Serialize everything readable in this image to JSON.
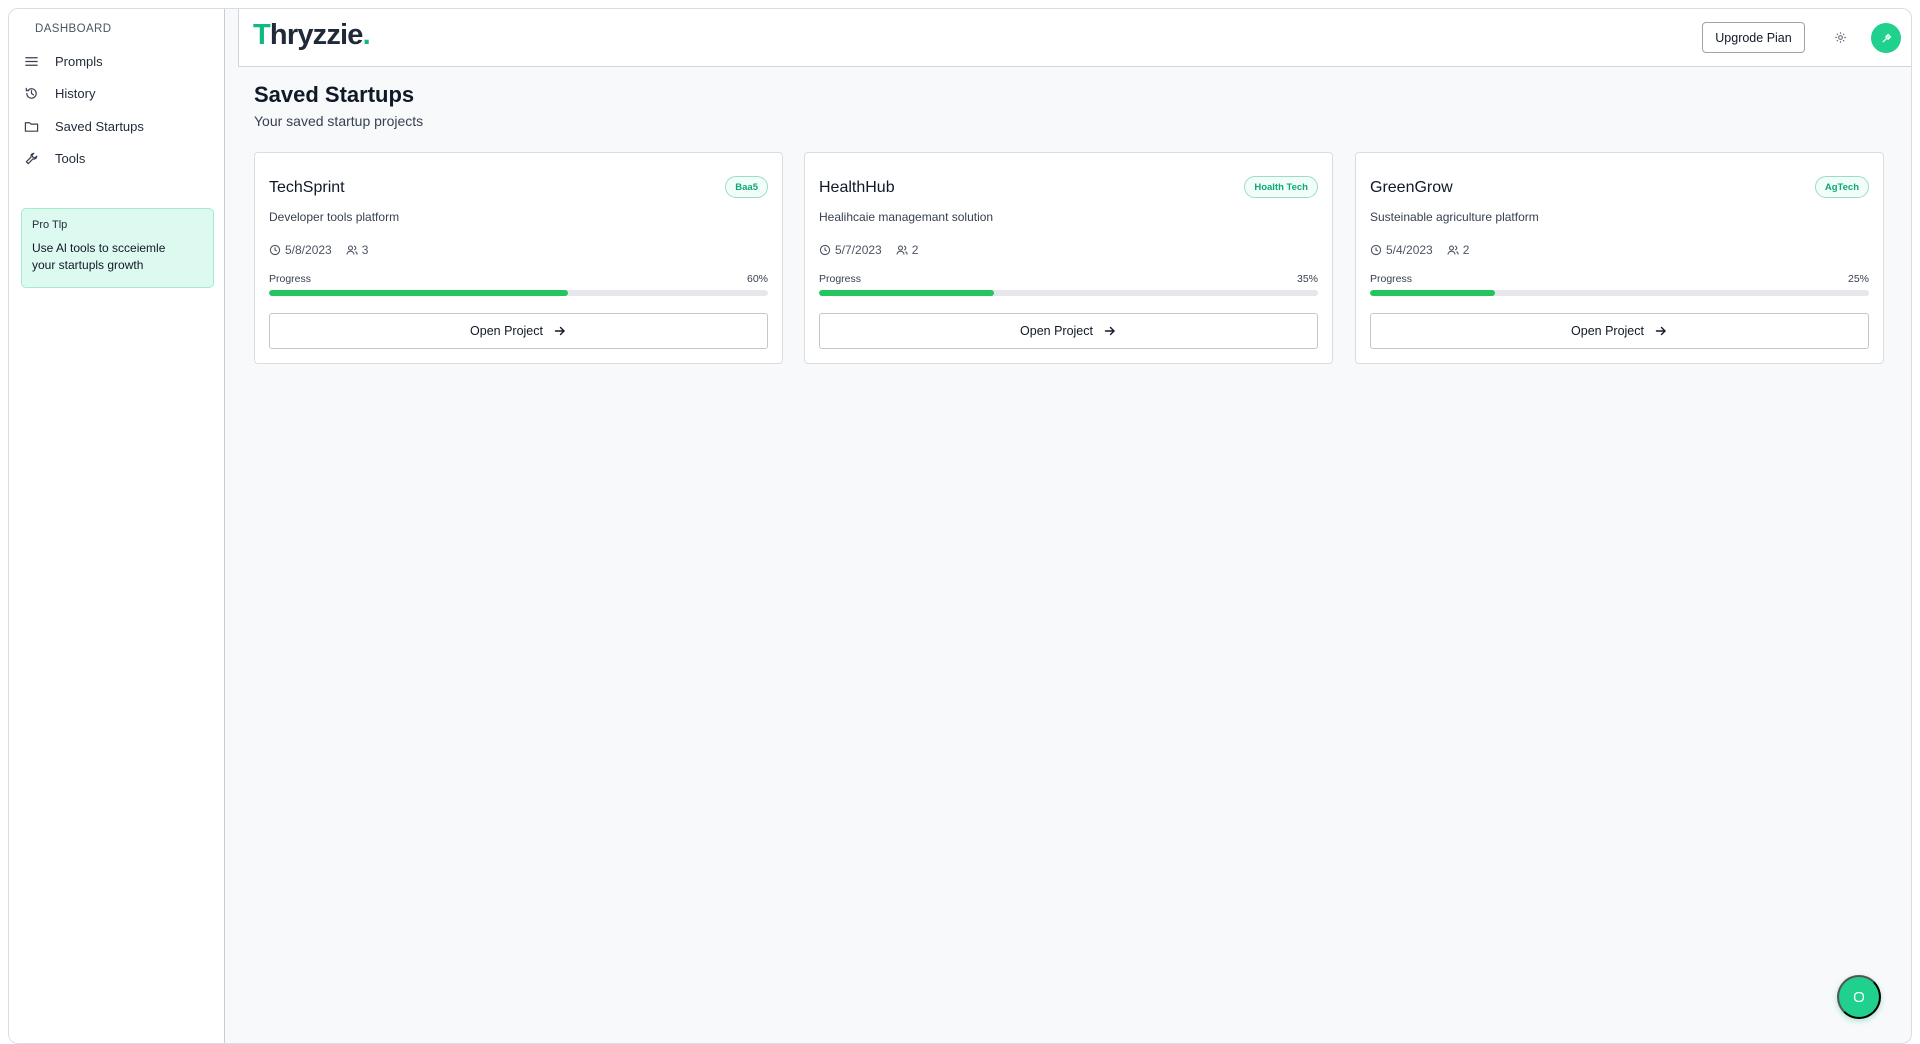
{
  "app": {
    "logo_first": "T",
    "logo_rest": "hryzzie",
    "logo_dot": ".",
    "accent_color": "#10b981"
  },
  "sidebar": {
    "section_title": "DASHBOARD",
    "items": [
      {
        "label": "Prompls",
        "icon": "menu-icon"
      },
      {
        "label": "History",
        "icon": "history-icon"
      },
      {
        "label": "Saved Startups",
        "icon": "folder-icon"
      },
      {
        "label": "Tools",
        "icon": "wrench-icon"
      }
    ],
    "protip": {
      "title": "Pro Tlp",
      "body": "Use Al tools to scceiemle your startupls growth"
    }
  },
  "header": {
    "upgrade_label": "Upgrode Pian",
    "settings_icon": "gear-icon",
    "avatar_icon": "user-icon"
  },
  "main": {
    "title": "Saved Startups",
    "subtitle": "Your saved startup projects",
    "progress_label": "Progress",
    "open_label": "Open Project",
    "cards": [
      {
        "name": "TechSprint",
        "tag": "Baa5",
        "description": "Developer tools platform",
        "date": "5/8/2023",
        "members": "3",
        "progress_label": "Progress",
        "progress_text": "60%",
        "progress": 0.6,
        "open_label": "Open Project"
      },
      {
        "name": "HealthHub",
        "tag": "Hoalth Tech",
        "description": "Healihcaie managemant solution",
        "date": "5/7/2023",
        "members": "2",
        "progress_label": "Progress",
        "progress_text": "35%",
        "progress": 0.35,
        "open_label": "Open Project"
      },
      {
        "name": "GreenGrow",
        "tag": "AgTech",
        "description": "Susteinable agriculture platform",
        "date": "5/4/2023",
        "members": "2",
        "progress_label": "Progress",
        "progress_text": "25%",
        "progress": 0.25,
        "open_label": "Open Project"
      }
    ]
  },
  "fab": {
    "icon": "chat-icon"
  }
}
